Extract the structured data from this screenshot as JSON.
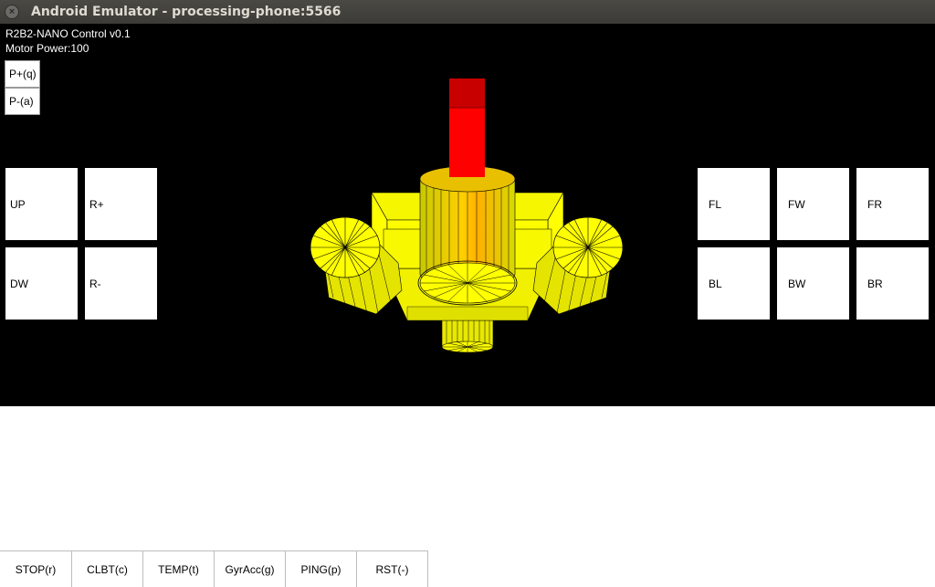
{
  "window": {
    "title": "Android Emulator - processing-phone:5566"
  },
  "app": {
    "name": "R2B2-NANO Control v0.1",
    "motor_power": "Motor Power:100"
  },
  "power_buttons": [
    "P+(q)",
    "P-(a)"
  ],
  "left_pad": {
    "up": "UP",
    "rotate_plus": "R+",
    "down": "DW",
    "rotate_minus": "R-"
  },
  "right_pad": {
    "fl": "FL",
    "fw": "FW",
    "fr": "FR",
    "bl": "BL",
    "bw": "BW",
    "br": "BR"
  },
  "bottom_bar": {
    "stop": "STOP(r)",
    "clbt": "CLBT(c)",
    "temp": "TEMP(t)",
    "gyracc": "GyrAcc(g)",
    "ping": "PING(p)",
    "rst": "RST(-)"
  },
  "colors": {
    "screen_bg": "#000000",
    "model_yellow": "#ffff00",
    "model_red": "#ff0000"
  }
}
